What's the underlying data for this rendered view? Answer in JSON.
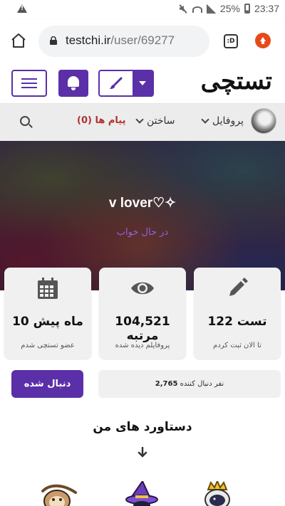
{
  "status_bar": {
    "battery": "25%",
    "time": "23:37",
    "icons": [
      "warning-icon",
      "mute-icon",
      "wifi-icon",
      "signal-icon",
      "battery-icon"
    ]
  },
  "browser": {
    "url_host": "testchi.ir",
    "url_path": "/user/69277",
    "tabs_label": ":D"
  },
  "site_header": {
    "logo": "تستچی"
  },
  "nav": {
    "profile": "پروفایل",
    "create": "ساختن",
    "messages": "پیام ها (0)"
  },
  "profile": {
    "name": "v lover♡✧",
    "status": "در حال خواب"
  },
  "stats": [
    {
      "value": "122 تست",
      "label": "تا الان ثبت کردم",
      "icon": "pencil-icon"
    },
    {
      "value": "104,521 مرتبه",
      "label": "پروفایلم دیده شده",
      "icon": "eye-icon"
    },
    {
      "value": "10 ماه پیش",
      "label": "عضو تستچی شدم",
      "icon": "calendar-icon"
    }
  ],
  "follow": {
    "button": "دنبال شده",
    "followers_count": "2,765",
    "followers_label": "نفر دنبال کننده"
  },
  "achievements": {
    "title": "دستاورد های من"
  },
  "colors": {
    "accent": "#5b2fa8",
    "message_red": "#b23030",
    "status_purple": "#8a66e0"
  }
}
